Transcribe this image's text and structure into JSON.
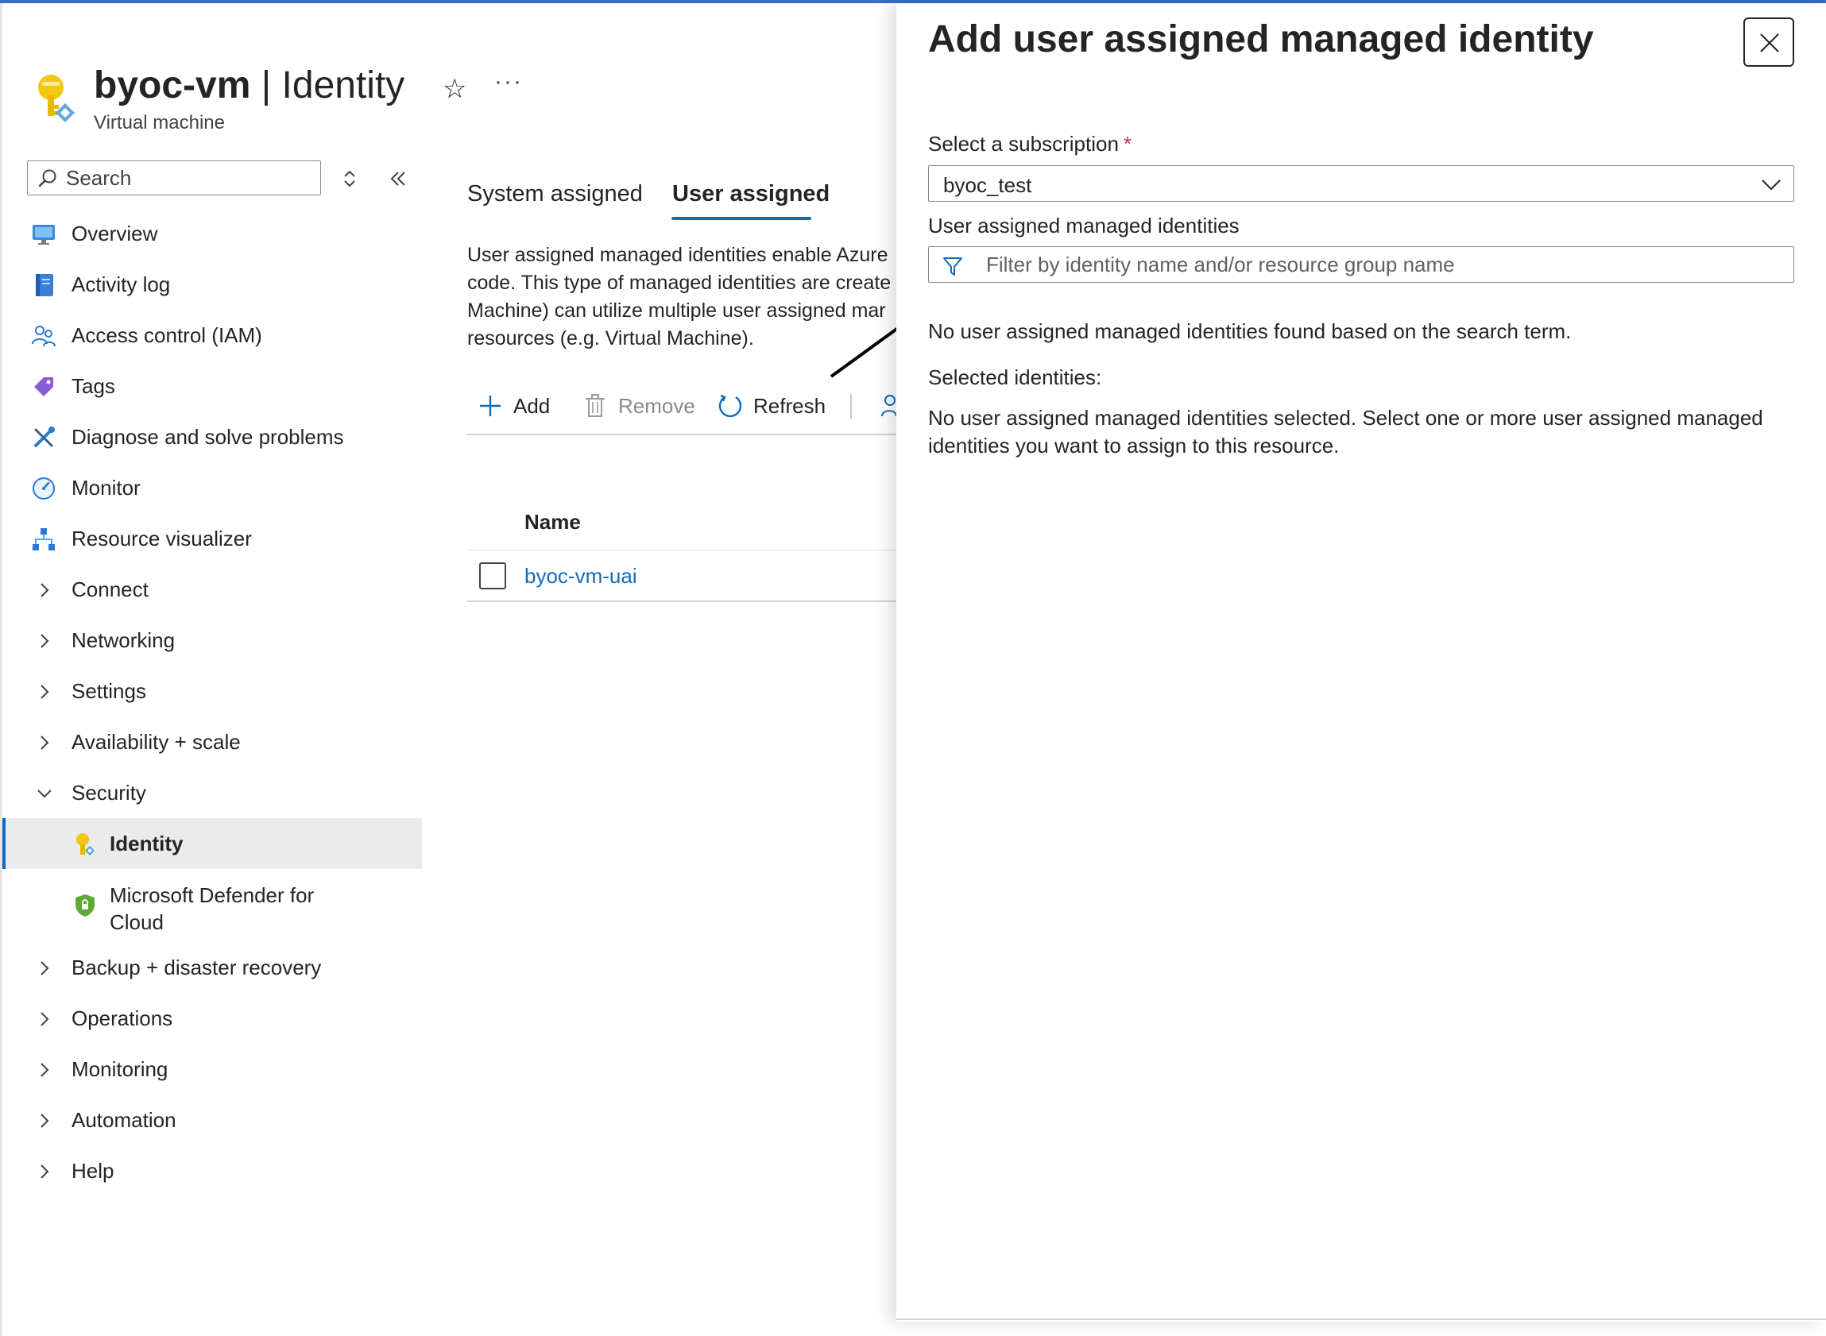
{
  "header": {
    "resource_name": "byoc-vm",
    "separator": " | ",
    "page_name": "Identity",
    "subtitle": "Virtual machine",
    "more": "···"
  },
  "sidebar": {
    "search": {
      "placeholder": "Search"
    },
    "items": [
      {
        "label": "Overview",
        "icon": "monitor-screen-icon"
      },
      {
        "label": "Activity log",
        "icon": "activity-log-icon"
      },
      {
        "label": "Access control (IAM)",
        "icon": "people-icon"
      },
      {
        "label": "Tags",
        "icon": "tag-icon"
      },
      {
        "label": "Diagnose and solve problems",
        "icon": "wrench-icon"
      },
      {
        "label": "Monitor",
        "icon": "gauge-icon"
      },
      {
        "label": "Resource visualizer",
        "icon": "hierarchy-icon"
      },
      {
        "label": "Connect",
        "expandable": true
      },
      {
        "label": "Networking",
        "expandable": true
      },
      {
        "label": "Settings",
        "expandable": true
      },
      {
        "label": "Availability + scale",
        "expandable": true
      },
      {
        "label": "Security",
        "expanded": true
      },
      {
        "label": "Identity",
        "icon": "key-icon",
        "active": true
      },
      {
        "label": "Microsoft Defender for Cloud",
        "icon": "shield-icon"
      },
      {
        "label": "Backup + disaster recovery",
        "expandable": true
      },
      {
        "label": "Operations",
        "expandable": true
      },
      {
        "label": "Monitoring",
        "expandable": true
      },
      {
        "label": "Automation",
        "expandable": true
      },
      {
        "label": "Help",
        "expandable": true
      }
    ]
  },
  "main": {
    "tabs": [
      {
        "label": "System assigned"
      },
      {
        "label": "User assigned",
        "active": true
      }
    ],
    "description": "User assigned managed identities enable Azure resources to authenticate to cloud services without storing credentials in code. This type of managed identities are created as standalone Azure resources, and a single resource (e.g. Virtual Machine) can utilize multiple user assigned managed identities. Similarly, a single user assigned managed identity can be shared across multiple resources (e.g. Virtual Machine).",
    "description_visible": "User assigned managed identities enable Azure code. This type of managed identities are create Machine) can utilize multiple user assigned mar resources (e.g. Virtual Machine).",
    "toolbar": {
      "add": "Add",
      "remove": "Remove",
      "refresh": "Refresh"
    },
    "table": {
      "columns": [
        "Name"
      ],
      "rows": [
        {
          "name": "byoc-vm-uai"
        }
      ]
    }
  },
  "blade": {
    "title": "Add user assigned managed identity",
    "subscription_label": "Select a subscription",
    "required_marker": "*",
    "subscription_value": "byoc_test",
    "identities_label": "User assigned managed identities",
    "filter_placeholder": "Filter by identity name and/or resource group name",
    "no_results": "No user assigned managed identities found based on the search term.",
    "selected_label": "Selected identities:",
    "none_selected": "No user assigned managed identities selected. Select one or more user assigned managed identities you want to assign to this resource."
  },
  "colors": {
    "accent": "#0f6cbd",
    "top_bar": "#2f6fd0",
    "required": "#c4314b"
  }
}
